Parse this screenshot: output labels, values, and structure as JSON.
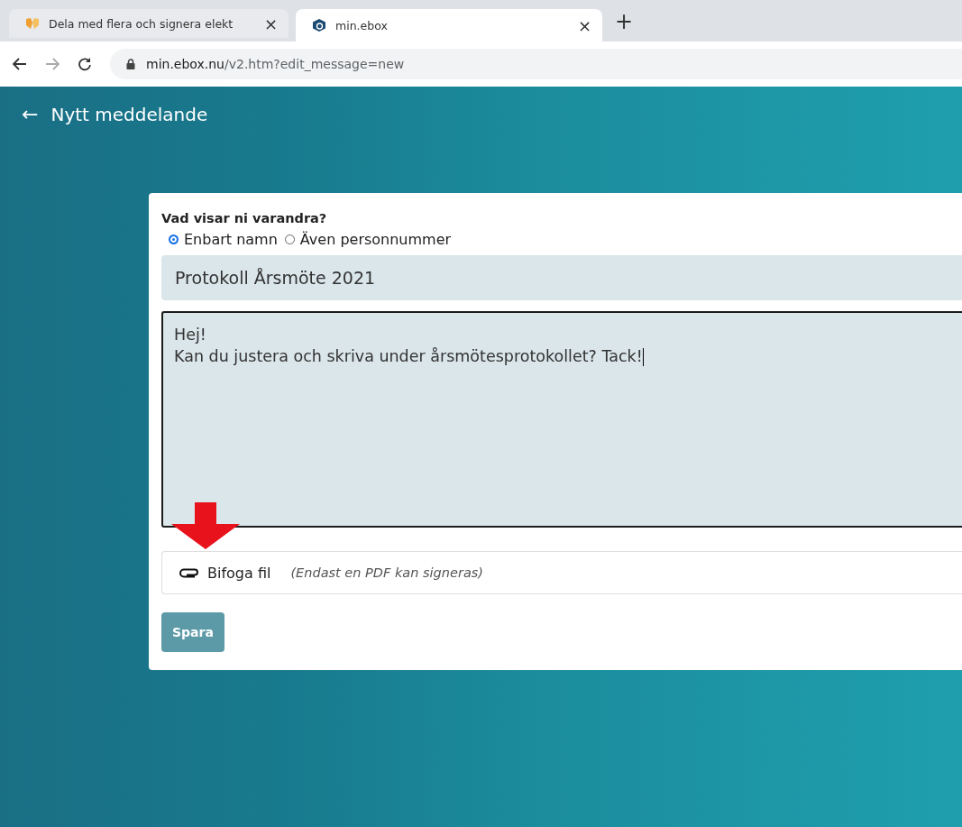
{
  "browser": {
    "tabs": [
      {
        "title": "Dela med flera och signera elekt",
        "selected": false,
        "close": "×"
      },
      {
        "title": "min.ebox",
        "selected": true,
        "close": "×"
      }
    ],
    "new_tab": "+",
    "address": {
      "host": "min.ebox.nu",
      "path": "/v2.htm?edit_message=new"
    }
  },
  "page": {
    "back": "←",
    "title": "Nytt meddelande"
  },
  "form": {
    "question": "Vad visar ni varandra?",
    "options": [
      {
        "label": "Enbart namn",
        "selected": true
      },
      {
        "label": "Även personnummer",
        "selected": false
      }
    ],
    "subject": "Protokoll Årsmöte 2021",
    "message": [
      "Hej!",
      "Kan du justera och skriva under årsmötesprotokollet? Tack!"
    ],
    "attach": {
      "label": "Bifoga fil",
      "hint": "(Endast en PDF kan signeras)"
    },
    "save": "Spara"
  }
}
